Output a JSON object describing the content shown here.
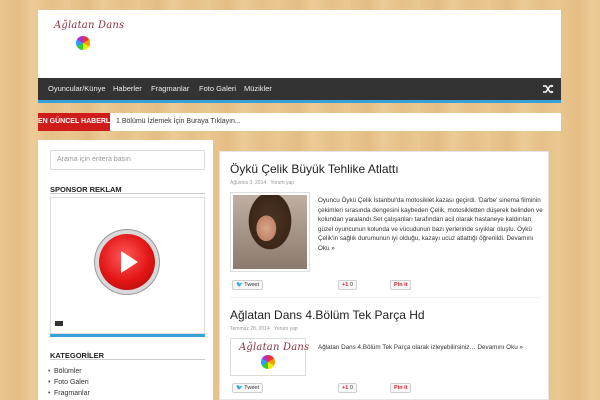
{
  "site": {
    "logo_text": "Ağlatan Dans"
  },
  "nav": {
    "items": [
      "Oyuncular/Künye",
      "Haberler",
      "Fragmanlar",
      "Foto Galeri",
      "Müzikler"
    ],
    "shuffle_icon": "shuffle-icon"
  },
  "ticker": {
    "label": "EN GÜNCEL HABERLER",
    "text": "1.Bölümü İzlemek İçin Buraya Tıklayın..."
  },
  "sidebar": {
    "search_placeholder": "Arama için entera basın",
    "sponsor_title": "SPONSOR REKLAM",
    "categories_title": "KATEGORİLER",
    "categories": [
      "Bölümler",
      "Foto Galeri",
      "Fragmanlar"
    ]
  },
  "posts": [
    {
      "title": "Öykü Çelik Büyük Tehlike Atlattı",
      "date": "Ağustos 3, 2014",
      "comment_link": "Yorum yap",
      "excerpt": "Oyuncu Öykü Çelik İstanbul'da motosiklet kazası geçirdi. 'Darbe' sinema filminin çekimleri sırasında dengesini kaybeden Çelik, motosikletten düşerek belinden ve kolundan yaralandı.Set çalışanları tarafından acil olarak hastaneye kaldırılan güzel oyuncunun kolunda ve vücudunun bazı yerlerinde sıyıklar oluştu. Öykü Çelik'in sağlık durumunun iyi olduğu, kazayı ucuz atlattığı öğrenildi. Devamını Oku »"
    },
    {
      "title": "Ağlatan Dans 4.Bölüm Tek Parça Hd",
      "date": "Temmuz 28, 2014",
      "comment_link": "Yorum yap",
      "excerpt": "Ağlatan Dans 4.Bölüm Tek Parça olarak izleyebilirsiniz… Devamını Oku »"
    }
  ],
  "share": {
    "tweet": "Tweet",
    "gplus": "+1",
    "gplus_count": "0",
    "pinit": "Pin it"
  },
  "colors": {
    "accent": "#3aa0d8",
    "nav_bg": "#333333",
    "ticker_label_bg": "#d01b1b"
  }
}
